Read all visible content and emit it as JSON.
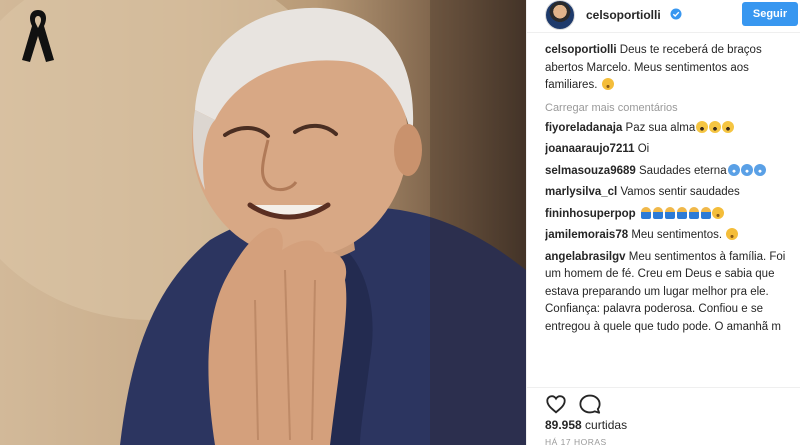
{
  "post": {
    "username": "celsoportiolli",
    "follow_label": "Seguir",
    "caption_user": "celsoportiolli",
    "caption_text": "Deus te receberá de braços abertos Marcelo. Meus sentimentos aos familiares."
  },
  "load_more_label": "Carregar mais comentários",
  "comments": [
    {
      "user": "fiyoreladanaja",
      "text": "Paz sua alma"
    },
    {
      "user": "joanaaraujo7211",
      "text": "Oi"
    },
    {
      "user": "selmasouza9689",
      "text": "Saudades eterna"
    },
    {
      "user": "marlysilva_cl",
      "text": "Vamos sentir saudades"
    },
    {
      "user": "fininhosuperpop",
      "text": ""
    },
    {
      "user": "jamilemorais78",
      "text": "Meu sentimentos."
    },
    {
      "user": "angelabrasilgv",
      "text": "Meu sentimentos à família. Foi um homem de fé. Creu em Deus e sabia que estava preparando um lugar melhor pra ele. Confiança: palavra poderosa. Confiou e se entregou à quele que tudo pode. O amanhã m"
    }
  ],
  "likes": {
    "count": "89.958",
    "label": "curtidas"
  },
  "timestamp": "HÁ 17 HORAS",
  "colors": {
    "accent": "#3897f0",
    "muted": "#999999"
  },
  "icons": [
    "mourning-ribbon-icon",
    "verified-badge-icon",
    "heart-icon",
    "comment-icon"
  ]
}
